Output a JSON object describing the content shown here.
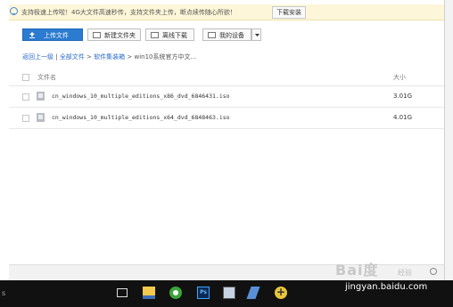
{
  "notice": {
    "text": "支持极速上传啦！4G大文件高速秒传，支持文件夹上传，断点续传随心所欲！",
    "button": "下载安装"
  },
  "toolbar": {
    "upload": "上传文件",
    "new_folder": "新建文件夹",
    "offline": "离线下载",
    "device": "我的设备"
  },
  "breadcrumb": {
    "back": "返回上一级",
    "sep": " | ",
    "all": "全部文件",
    "arrow1": " > ",
    "folder1": "软件集装箱",
    "arrow2": " > ",
    "current": "win10系统官方中文..."
  },
  "table": {
    "col_name": "文件名",
    "col_size": "大小",
    "rows": [
      {
        "name": "cn_windows_10_multiple_editions_x86_dvd_6846431.iso",
        "size": "3.01G"
      },
      {
        "name": "cn_windows_10_multiple_editions_x64_dvd_6848463.iso",
        "size": "4.01G"
      }
    ]
  },
  "watermark": {
    "logo": "Bai度",
    "tail": "经验"
  },
  "taskbar": {
    "left_text": "s",
    "ps_label": "Ps",
    "plus_label": "+"
  },
  "site": "jingyan.baidu.com"
}
